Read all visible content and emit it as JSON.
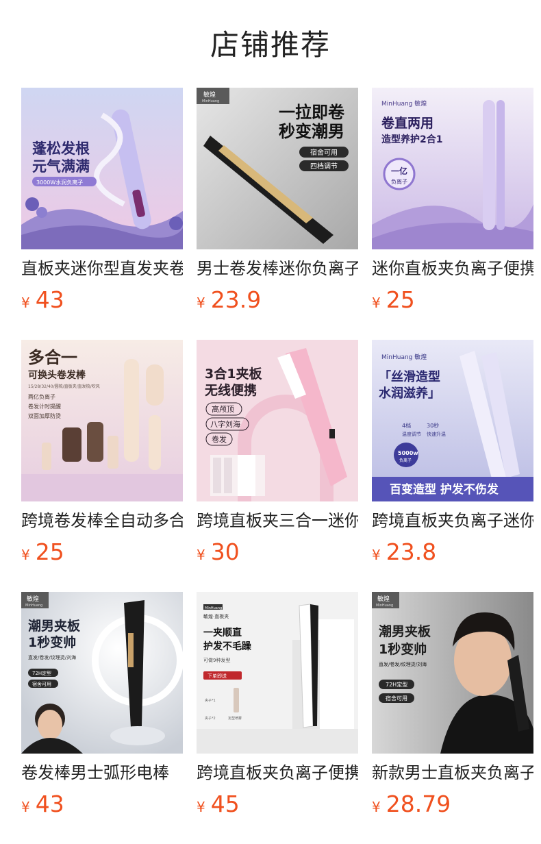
{
  "page": {
    "title": "店铺推荐"
  },
  "currency_symbol": "¥",
  "colors": {
    "price": "#f0501e"
  },
  "products": [
    {
      "title": "直板夹迷你型直发夹卷发棒",
      "price": "43",
      "image": {
        "headline_1": "蓬松发根",
        "headline_2": "元气满满",
        "tag": "3000W水润负离子"
      }
    },
    {
      "title": "男士卷发棒迷你负离子",
      "price": "23.9",
      "image": {
        "brand": "敏煌",
        "brand_sub": "MinHuang",
        "headline_1": "一拉即卷",
        "headline_2": "秒变潮男",
        "tag_1": "宿舍可用",
        "tag_2": "四档调节"
      }
    },
    {
      "title": "迷你直板夹负离子便携",
      "price": "25",
      "image": {
        "brand": "MinHuang 敏煌",
        "headline_1": "卷直两用",
        "headline_2": "造型养护2合1",
        "badge_1": "一亿",
        "badge_2": "负离子"
      }
    },
    {
      "title": "跨境卷发棒全自动多合一",
      "price": "25",
      "image": {
        "headline_1": "多合一",
        "headline_2": "可换头卷发棒",
        "spec": "15/28/32/40/圆梳/直板夹/直发梳/吹风",
        "bullet_1": "两亿负离子",
        "bullet_2": "卷发计时提醒",
        "bullet_3": "双面加厚防烫"
      }
    },
    {
      "title": "跨境直板夹三合一迷你",
      "price": "30",
      "image": {
        "headline_1": "3合1夹板",
        "headline_2": "无线便携",
        "tag_1": "高颅顶",
        "tag_2": "八字刘海",
        "tag_3": "卷发"
      }
    },
    {
      "title": "跨境直板夹负离子迷你",
      "price": "23.8",
      "image": {
        "brand": "MinHuang 敏煌",
        "headline_1": "「丝滑造型",
        "headline_2": "水润滋养」",
        "feature_1": "4档",
        "feature_1_sub": "温度调节",
        "feature_2": "30秒",
        "feature_2_sub": "快速升温",
        "badge_1": "5000w",
        "badge_2": "负离子",
        "banner": "百变造型 护发不伤发"
      }
    },
    {
      "title": "卷发棒男士弧形电棒",
      "price": "43",
      "image": {
        "brand": "敏煌",
        "brand_sub": "MinHuang",
        "headline_1": "潮男夹板",
        "headline_2": "1秒变帅",
        "sub": "直发/卷发/纹理烫/刘海",
        "tag_1": "72H定型",
        "tag_2": "宿舍可用"
      }
    },
    {
      "title": "跨境直板夹负离子便携",
      "price": "45",
      "image": {
        "brand": "MinHuang",
        "brand_sub": "敏煌·直板夹",
        "headline_1": "一夹顺直",
        "headline_2": "护发不毛躁",
        "sub": "可做9种发型",
        "tag": "下单即送",
        "label_1": "夹子*1",
        "label_2": "夹子*2",
        "label_3": "定型喷雾"
      }
    },
    {
      "title": "新款男士直板夹负离子",
      "price": "28.79",
      "image": {
        "brand": "敏煌",
        "brand_sub": "MinHuang",
        "headline_1": "潮男夹板",
        "headline_2": "1秒变帅",
        "sub": "直发/卷发/纹理烫/刘海",
        "tag_1": "72H定型",
        "tag_2": "宿舍可用"
      }
    }
  ]
}
